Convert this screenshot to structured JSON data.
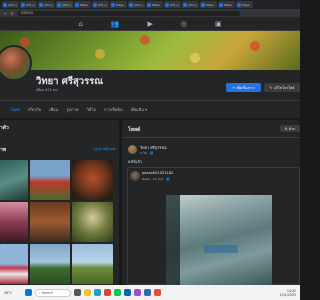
{
  "browser": {
    "tabs": [
      {
        "label": "(20+)"
      },
      {
        "label": "(20+)"
      },
      {
        "label": "(20+)"
      },
      {
        "label": "(20+)"
      },
      {
        "label": "Mess"
      },
      {
        "label": "(20+)"
      },
      {
        "label": "Mess"
      },
      {
        "label": "(20+)"
      },
      {
        "label": "Mess"
      },
      {
        "label": "(20+)"
      },
      {
        "label": "(20+)"
      },
      {
        "label": "Mess"
      },
      {
        "label": "Mess"
      },
      {
        "label": "Mess"
      }
    ],
    "url": "l25034"
  },
  "profile": {
    "name": "วิทยา ศรีสุวรรณ",
    "friends": "เพื่อน 421 คน",
    "add_story_label": "+ เพิ่มเรื่องราว",
    "edit_profile_label": "✎ แก้ไขโปรไฟล์"
  },
  "profile_tabs": [
    "โพสต์",
    "เกี่ยวกับ",
    "เพื่อน",
    "รูปภาพ",
    "วิดีโอ",
    "การเช็คอิน",
    "เพิ่มเติม ▾"
  ],
  "left": {
    "intro_title": "ำตัว",
    "photos_title": "าพ",
    "see_all_photos": "ดูรูปภาพทั้งหมด"
  },
  "feed": {
    "title": "โพสต์",
    "filter_label": "⇅ ตัวก",
    "post": {
      "author": "วิทยา ศรีสุวรรณ",
      "time": "3 วัน · 🌐",
      "text": "แชร์แล้ว",
      "shared_author": "peace001022182",
      "shared_time": "Reels · 11 ม.ค. · 🌐"
    }
  },
  "taskbar": {
    "weather": "28°C",
    "search_placeholder": "Search",
    "time": "14:32",
    "date": "15/1/2025"
  },
  "colors": {
    "accent": "#2d88ff",
    "button_blue": "#2374e1",
    "surface": "#242526",
    "background": "#18191a"
  }
}
